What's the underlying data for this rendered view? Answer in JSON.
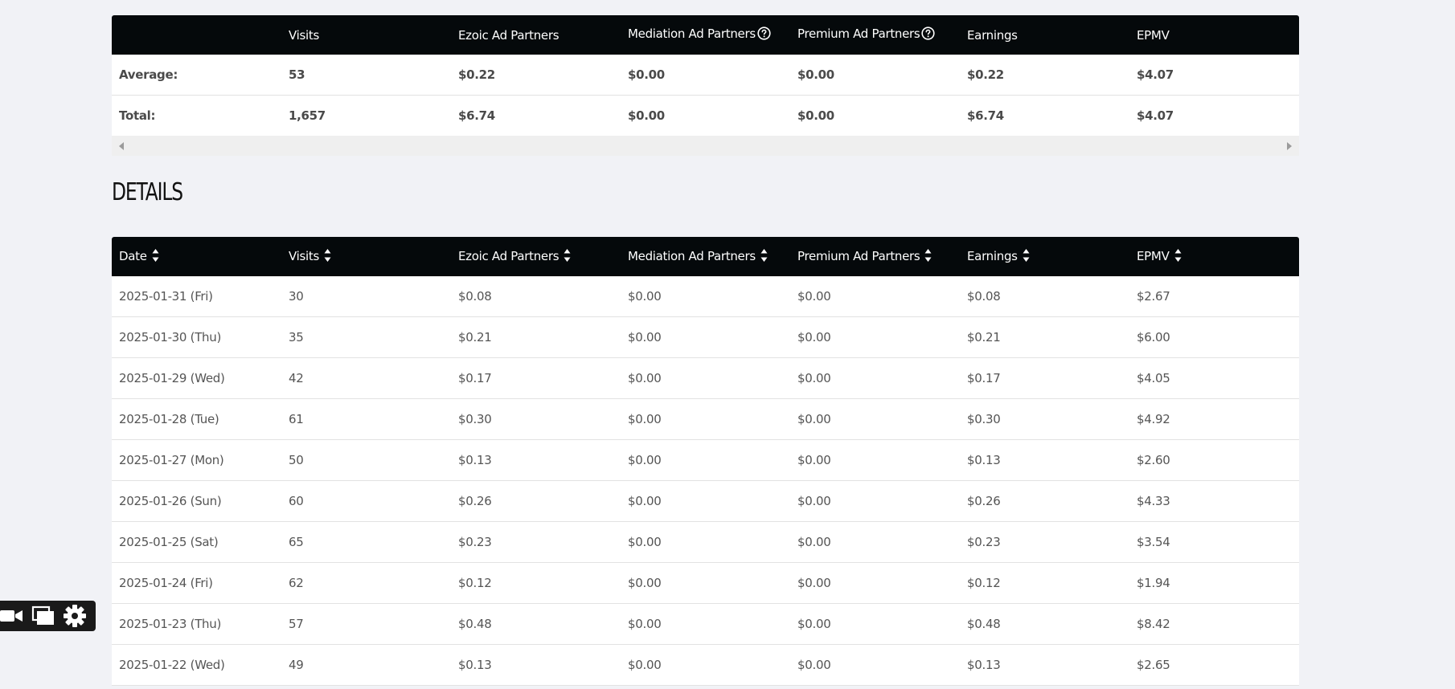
{
  "summary": {
    "headers": [
      "",
      "Visits",
      "Ezoic Ad Partners",
      "Mediation Ad Partners",
      "Premium Ad Partners",
      "Earnings",
      "EPMV"
    ],
    "rows": [
      [
        "Average:",
        "53",
        "$0.22",
        "$0.00",
        "$0.00",
        "$0.22",
        "$4.07"
      ],
      [
        "Total:",
        "1,657",
        "$6.74",
        "$0.00",
        "$0.00",
        "$6.74",
        "$4.07"
      ]
    ]
  },
  "details": {
    "title": "DETAILS",
    "headers": [
      "Date",
      "Visits",
      "Ezoic Ad Partners",
      "Mediation Ad Partners",
      "Premium Ad Partners",
      "Earnings",
      "EPMV"
    ],
    "rows": [
      [
        "2025-01-31 (Fri)",
        "30",
        "$0.08",
        "$0.00",
        "$0.00",
        "$0.08",
        "$2.67"
      ],
      [
        "2025-01-30 (Thu)",
        "35",
        "$0.21",
        "$0.00",
        "$0.00",
        "$0.21",
        "$6.00"
      ],
      [
        "2025-01-29 (Wed)",
        "42",
        "$0.17",
        "$0.00",
        "$0.00",
        "$0.17",
        "$4.05"
      ],
      [
        "2025-01-28 (Tue)",
        "61",
        "$0.30",
        "$0.00",
        "$0.00",
        "$0.30",
        "$4.92"
      ],
      [
        "2025-01-27 (Mon)",
        "50",
        "$0.13",
        "$0.00",
        "$0.00",
        "$0.13",
        "$2.60"
      ],
      [
        "2025-01-26 (Sun)",
        "60",
        "$0.26",
        "$0.00",
        "$0.00",
        "$0.26",
        "$4.33"
      ],
      [
        "2025-01-25 (Sat)",
        "65",
        "$0.23",
        "$0.00",
        "$0.00",
        "$0.23",
        "$3.54"
      ],
      [
        "2025-01-24 (Fri)",
        "62",
        "$0.12",
        "$0.00",
        "$0.00",
        "$0.12",
        "$1.94"
      ],
      [
        "2025-01-23 (Thu)",
        "57",
        "$0.48",
        "$0.00",
        "$0.00",
        "$0.48",
        "$8.42"
      ],
      [
        "2025-01-22 (Wed)",
        "49",
        "$0.13",
        "$0.00",
        "$0.00",
        "$0.13",
        "$2.65"
      ]
    ]
  },
  "icons": {
    "help": "question-circle-icon",
    "sort": "sort-arrows-icon",
    "toolbar": [
      "video-camera-icon",
      "windows-icon",
      "gear-icon"
    ]
  },
  "colors": {
    "header_bg": "#05090b",
    "page_bg": "#f1f2f6",
    "row_bg": "#ffffff"
  }
}
